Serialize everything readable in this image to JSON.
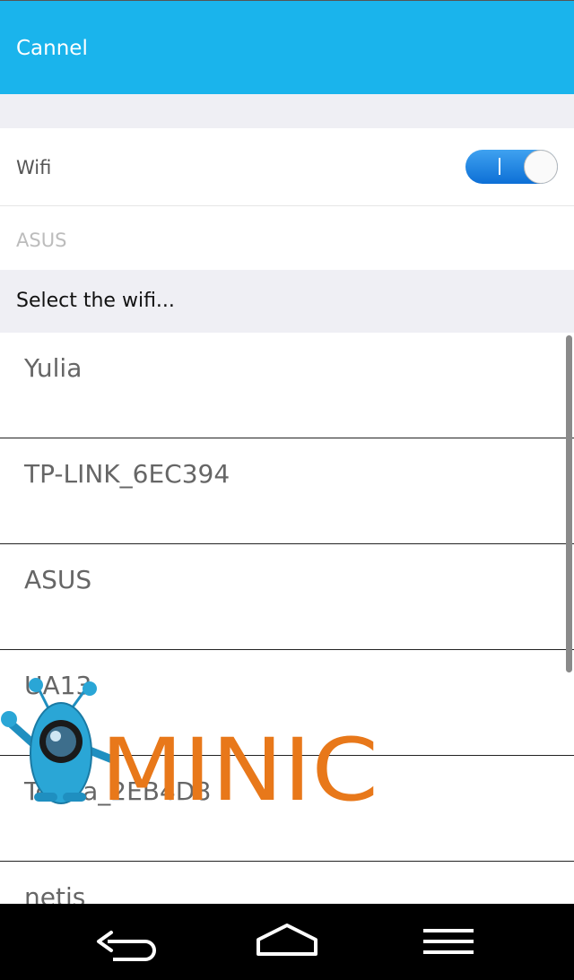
{
  "header": {
    "title": "Cannel"
  },
  "wifi": {
    "label": "Wifi",
    "enabled": true
  },
  "current_network": {
    "ssid": "ASUS"
  },
  "section": {
    "label": "Select the wifi..."
  },
  "networks": [
    {
      "ssid": "Yulia"
    },
    {
      "ssid": "TP-LINK_6EC394"
    },
    {
      "ssid": "ASUS"
    },
    {
      "ssid": "UA13"
    },
    {
      "ssid": "Tenda_2EB4D8"
    },
    {
      "ssid": "netis"
    }
  ],
  "watermark": {
    "text": "MINIC",
    "color": "#e8781a"
  },
  "colors": {
    "accent": "#1ab4ec",
    "toggle_on": "#1a7fe0",
    "background": "#efeff4"
  },
  "navigation": {
    "icons": [
      "back-icon",
      "home-icon",
      "menu-icon"
    ]
  }
}
